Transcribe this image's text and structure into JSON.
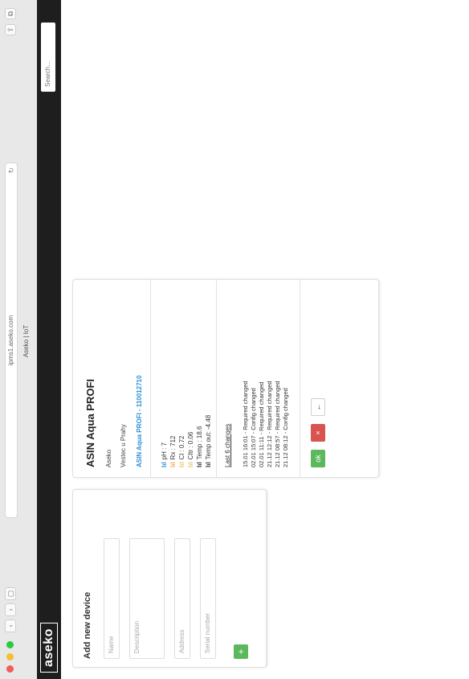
{
  "browser": {
    "url": "ipms1.aseko.com",
    "tab_title": "Aseko | IoT",
    "reload_glyph": "↻",
    "nav_glyphs": [
      "‹",
      "›",
      "▢"
    ],
    "right_glyphs": [
      "⇪",
      "⧉"
    ],
    "traffic_colors": [
      "#ef5f57",
      "#f6bd32",
      "#29c940"
    ]
  },
  "header": {
    "logo": "aseko",
    "search_placeholder": "Search..."
  },
  "add_device": {
    "title": "Add new device",
    "name_placeholder": "Name",
    "description_placeholder": "Description",
    "address_placeholder": "Address",
    "serial_placeholder": "Serial number",
    "add_button": "+"
  },
  "device": {
    "name": "ASIN Aqua PROFI",
    "owner": "Aseko",
    "location": "Vestec u Prahy",
    "model": "ASIN Aqua PROFI - 110012710",
    "readings": [
      {
        "icon": "lıl",
        "label": "pH : 7",
        "color": "#2b8fd6"
      },
      {
        "icon": "lıl",
        "label": "Rx : 712",
        "color": "#f0ad4e"
      },
      {
        "icon": "lıl",
        "label": "Cl : 0.72",
        "color": "#f0c36b"
      },
      {
        "icon": "lıl",
        "label": "Cltr : 0.06",
        "color": "#f0c36b"
      },
      {
        "icon": "lıl",
        "label": "Temp : 18.6",
        "color": "#333333"
      },
      {
        "icon": "lıl",
        "label": "Temp out: -4.48",
        "color": "#333333"
      }
    ],
    "changes_title": "Last 6 changes",
    "changes": [
      "15.01 16:01 - Required changed",
      "02.01 15:07 - Config changed",
      "02.01 11:11 - Required changed",
      "21.12 12:12 - Required changed",
      "21.12 08:57 - Required changed",
      "21.12 08:12 - Config changed"
    ],
    "actions": {
      "ok": "ok",
      "delete": "×",
      "back": "←"
    }
  }
}
